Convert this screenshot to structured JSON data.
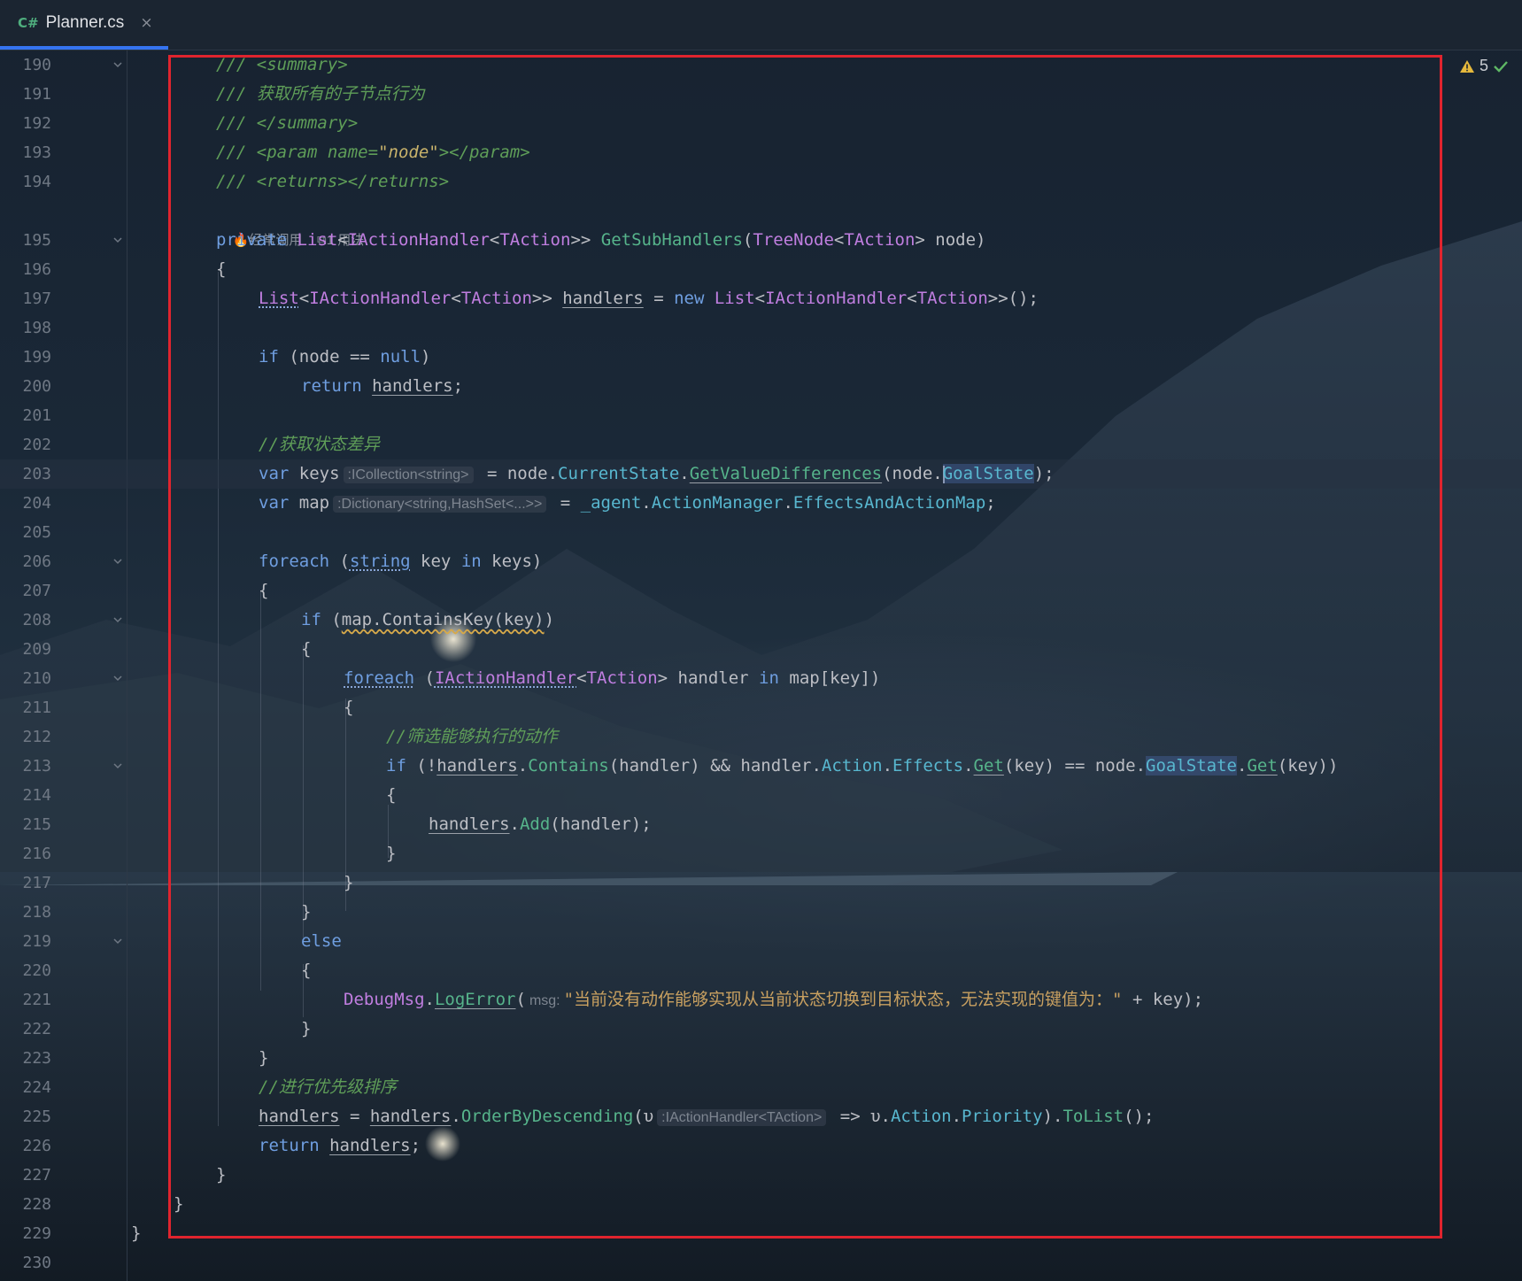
{
  "tab": {
    "lang_badge": "C#",
    "file_name": "Planner.cs",
    "close_glyph": "×"
  },
  "inspection": {
    "warning_count": "5"
  },
  "codelens": {
    "usage_hint": "经常调用",
    "usages": "1 用法"
  },
  "hints": {
    "keys_type": ":ICollection<string>",
    "map_type": ":Dictionary<string,HashSet<...>>",
    "msg_label": "msg:",
    "lambda_type": ":IActionHandler<TAction>"
  },
  "line_numbers": [
    "190",
    "191",
    "192",
    "193",
    "194",
    "195",
    "196",
    "197",
    "198",
    "199",
    "200",
    "201",
    "202",
    "203",
    "204",
    "205",
    "206",
    "207",
    "208",
    "209",
    "210",
    "211",
    "212",
    "213",
    "214",
    "215",
    "216",
    "217",
    "218",
    "219",
    "220",
    "221",
    "222",
    "223",
    "224",
    "225",
    "226",
    "227",
    "228",
    "229",
    "230"
  ],
  "tokens": {
    "l190": [
      "/// ",
      "<summary>"
    ],
    "l191": [
      "/// ",
      "获取所有的子节点行为"
    ],
    "l192": [
      "/// ",
      "</summary>"
    ],
    "l193": [
      "/// ",
      "<param ",
      "name",
      "=",
      "\"node\"",
      "></param>"
    ],
    "l194": [
      "/// ",
      "<returns></returns>"
    ],
    "l195": [
      "private",
      " ",
      "List",
      "<",
      "IActionHandler",
      "<",
      "TAction",
      ">> ",
      "GetSubHandlers",
      "(",
      "TreeNode",
      "<",
      "TAction",
      "> node)"
    ],
    "l196": [
      "{"
    ],
    "l197": [
      "List",
      "<",
      "IActionHandler",
      "<",
      "TAction",
      ">> ",
      "handlers",
      " = ",
      "new",
      " ",
      "List",
      "<",
      "IActionHandler",
      "<",
      "TAction",
      ">>();"
    ],
    "l199": [
      "if",
      " (node == ",
      "null",
      ")"
    ],
    "l200": [
      "return",
      " ",
      "handlers",
      ";"
    ],
    "l202": [
      "//获取状态差异"
    ],
    "l203": [
      "var",
      " keys",
      " = node.",
      "CurrentState",
      ".",
      "GetValueDifferences",
      "(node.",
      "GoalState",
      ");"
    ],
    "l204": [
      "var",
      " map",
      " = ",
      "_agent",
      ".",
      "ActionManager",
      ".",
      "EffectsAndActionMap",
      ";"
    ],
    "l206": [
      "foreach",
      " (",
      "string",
      " key ",
      "in",
      " keys)"
    ],
    "l207": [
      "{"
    ],
    "l208": [
      "if",
      " (",
      "map.ContainsKey(key)",
      ")"
    ],
    "l209": [
      "{"
    ],
    "l210": [
      "foreach",
      " (",
      "IActionHandler",
      "<",
      "TAction",
      "> handler ",
      "in",
      " map[key])"
    ],
    "l211": [
      "{"
    ],
    "l212": [
      "//筛选能够执行的动作"
    ],
    "l213": [
      "if",
      " (!",
      "handlers",
      ".",
      "Contains",
      "(handler) && handler.",
      "Action",
      ".",
      "Effects",
      ".",
      "Get",
      "(key) == node.",
      "GoalState",
      ".",
      "Get",
      "(key))"
    ],
    "l214": [
      "{"
    ],
    "l215": [
      "handlers",
      ".",
      "Add",
      "(handler);"
    ],
    "l216": [
      "}"
    ],
    "l217": [
      "}"
    ],
    "l218": [
      "}"
    ],
    "l219": [
      "else"
    ],
    "l220": [
      "{"
    ],
    "l221": [
      "DebugMsg",
      ".",
      "LogError",
      "(",
      "\"当前没有动作能够实现从当前状态切换到目标状态，无法实现的键值为：\"",
      " + key);"
    ],
    "l222": [
      "}"
    ],
    "l223": [
      "}"
    ],
    "l224": [
      "//进行优先级排序"
    ],
    "l225": [
      "handlers",
      " = ",
      "handlers",
      ".",
      "OrderByDescending",
      "(υ",
      " => υ.",
      "Action",
      ".",
      "Priority",
      ").",
      "ToList",
      "();"
    ],
    "l226": [
      "return",
      " ",
      "handlers",
      ";"
    ],
    "l227": [
      "}"
    ],
    "l228": [
      "}"
    ],
    "l229": [
      "}"
    ]
  },
  "colors": {
    "keyword": "#6f9ee0",
    "type": "#c07ee0",
    "method": "#56b48b",
    "property": "#58b7cf",
    "comment": "#5f9e58",
    "string": "#c8a060",
    "highlight_box": "#e0242e",
    "tab_accent": "#3574f0"
  },
  "icons": [
    "csharp-file-icon",
    "close-icon",
    "warning-icon",
    "check-icon",
    "fire-icon",
    "usages-icon",
    "fold-chevron-icon"
  ]
}
